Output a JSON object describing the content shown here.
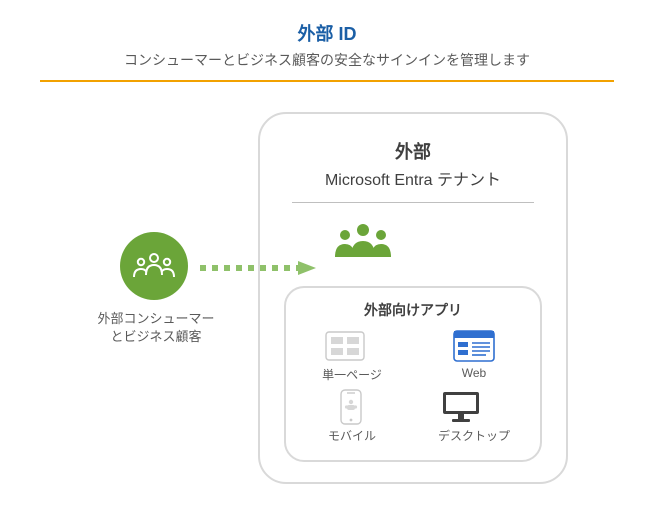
{
  "header": {
    "title": "外部 ID",
    "subtitle": "コンシューマーとビジネス顧客の安全なサインインを管理します"
  },
  "left": {
    "label_line1": "外部コンシューマー",
    "label_line2": "とビジネス顧客"
  },
  "panel": {
    "title1": "外部",
    "title2": "Microsoft Entra テナント"
  },
  "apps": {
    "title": "外部向けアプリ",
    "items": {
      "spa": {
        "label": "単一ページ"
      },
      "web": {
        "label": "Web"
      },
      "mobile": {
        "label": "モバイル"
      },
      "desktop": {
        "label": "デスクトップ"
      }
    }
  },
  "colors": {
    "accent_blue": "#1b5fa6",
    "accent_orange": "#f2a100",
    "brand_green": "#6ba539",
    "ms_blue": "#2f6fd0",
    "border_gray": "#d9d9d9",
    "text_gray": "#5a5a5a"
  }
}
